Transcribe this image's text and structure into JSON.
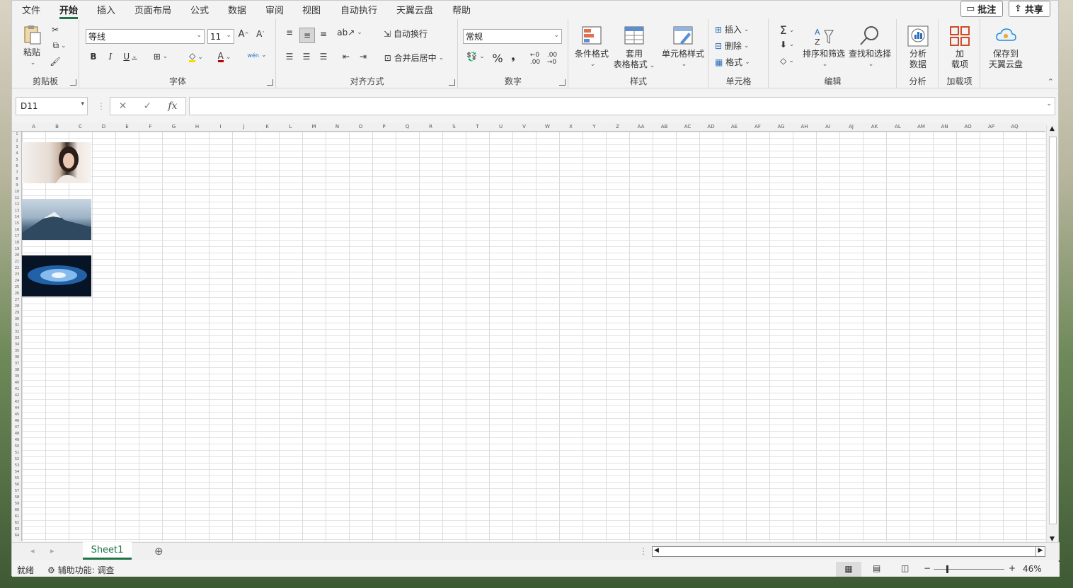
{
  "menu": {
    "tabs": [
      "文件",
      "开始",
      "插入",
      "页面布局",
      "公式",
      "数据",
      "审阅",
      "视图",
      "自动执行",
      "天翼云盘",
      "帮助"
    ],
    "active_tab": "开始",
    "comment_label": "批注",
    "share_label": "共享"
  },
  "ribbon": {
    "clipboard": {
      "paste": "粘贴",
      "label": "剪贴板"
    },
    "font": {
      "name": "等线",
      "size": "11",
      "label": "字体",
      "phonetic": "wén"
    },
    "alignment": {
      "wrap": "自动换行",
      "merge": "合并后居中",
      "label": "对齐方式"
    },
    "number": {
      "format": "常规",
      "label": "数字",
      "percent": "%"
    },
    "styles": {
      "conditional": "条件格式",
      "table_a": "套用",
      "table_b": "表格格式",
      "cell_styles": "单元格样式",
      "label": "样式"
    },
    "cells": {
      "insert": "插入",
      "delete": "删除",
      "format": "格式",
      "label": "单元格"
    },
    "editing": {
      "sort": "排序和筛选",
      "find": "查找和选择",
      "label": "编辑"
    },
    "analysis": {
      "analyze_a": "分析",
      "analyze_b": "数据",
      "label": "分析"
    },
    "addins": {
      "a": "加",
      "b": "载项",
      "label": "加载项"
    },
    "cloud": {
      "a": "保存到",
      "b": "天翼云盘"
    }
  },
  "formula_bar": {
    "name_box": "D11",
    "formula": ""
  },
  "grid": {
    "columns": [
      "A",
      "B",
      "C",
      "D",
      "E",
      "F",
      "G",
      "H",
      "I",
      "J",
      "K",
      "L",
      "M",
      "N",
      "O",
      "P",
      "Q",
      "R",
      "S",
      "T",
      "U",
      "V",
      "W",
      "X",
      "Y",
      "Z",
      "AA",
      "AB",
      "AC",
      "AD",
      "AE",
      "AF",
      "AG",
      "AH",
      "AI",
      "AJ",
      "AK",
      "AL",
      "AM",
      "AN",
      "AO",
      "AP",
      "AQ"
    ],
    "row_count": 64
  },
  "sheets": {
    "tabs": [
      "Sheet1"
    ],
    "active": "Sheet1"
  },
  "status": {
    "ready": "就绪",
    "accessibility": "辅助功能: 调查",
    "zoom": "46%"
  },
  "icons": {
    "paste": "paste-icon",
    "cut": "scissors-icon",
    "copy": "copy-icon",
    "format_painter": "brush-icon",
    "bold": "B",
    "italic": "I",
    "underline": "U"
  }
}
